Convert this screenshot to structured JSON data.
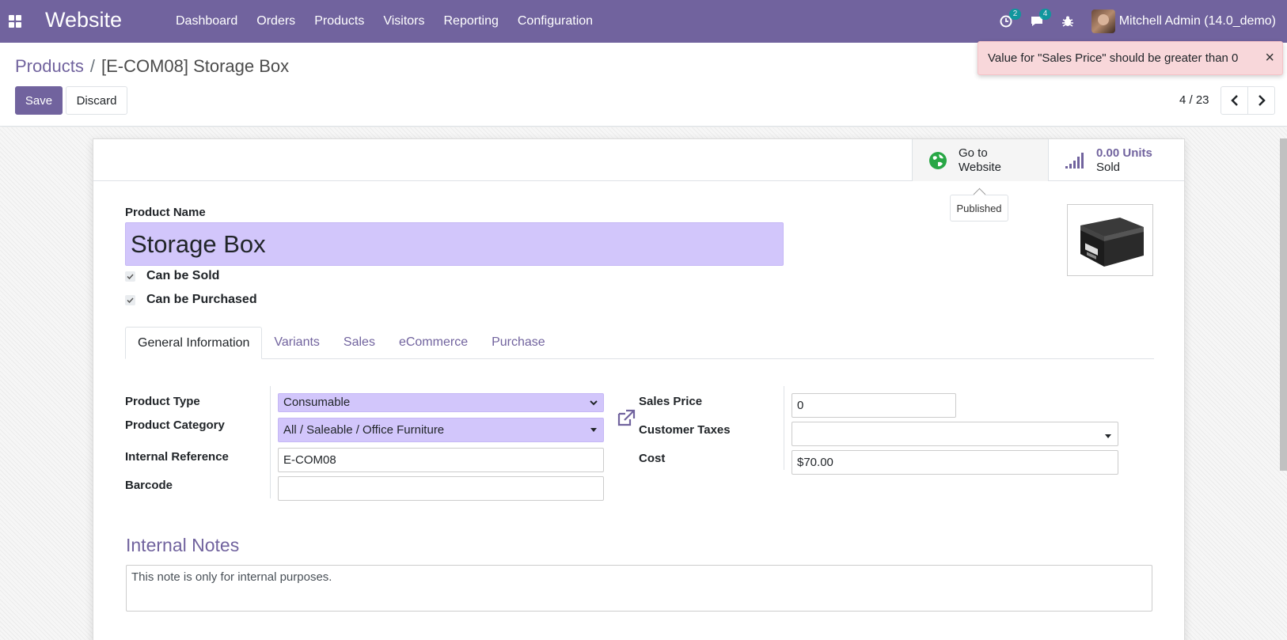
{
  "navbar": {
    "brand": "Website",
    "menu": [
      "Dashboard",
      "Orders",
      "Products",
      "Visitors",
      "Reporting",
      "Configuration"
    ],
    "activity_count": "2",
    "messages_count": "4",
    "user_name": "Mitchell Admin (14.0_demo)",
    "bg_color": "#71639e"
  },
  "breadcrumb": {
    "parent": "Products",
    "separator": "/",
    "current": "[E-COM08] Storage Box"
  },
  "actions": {
    "save_label": "Save",
    "discard_label": "Discard"
  },
  "pager": {
    "value": "4 / 23"
  },
  "notification": {
    "message": "Value for \"Sales Price\" should be greater than 0",
    "close": "×"
  },
  "smart_buttons": {
    "website_line1": "Go to",
    "website_line2": "Website",
    "tooltip": "Published",
    "sold_value": "0.00 Units",
    "sold_label": "Sold"
  },
  "form": {
    "product_name_label": "Product Name",
    "product_name": "Storage Box",
    "can_be_sold_label": "Can be Sold",
    "can_be_purchased_label": "Can be Purchased",
    "tabs": [
      "General Information",
      "Variants",
      "Sales",
      "eCommerce",
      "Purchase"
    ],
    "active_tab": "General Information",
    "fields": {
      "product_type_label": "Product Type",
      "product_type": "Consumable",
      "product_category_label": "Product Category",
      "product_category": "All / Saleable / Office Furniture",
      "internal_reference_label": "Internal Reference",
      "internal_reference": "E-COM08",
      "barcode_label": "Barcode",
      "barcode": "",
      "sales_price_label": "Sales Price",
      "sales_price": "0",
      "customer_taxes_label": "Customer Taxes",
      "customer_taxes": "",
      "cost_label": "Cost",
      "cost": "$70.00"
    },
    "notes_title": "Internal Notes",
    "notes": "This note is only for internal purposes."
  }
}
